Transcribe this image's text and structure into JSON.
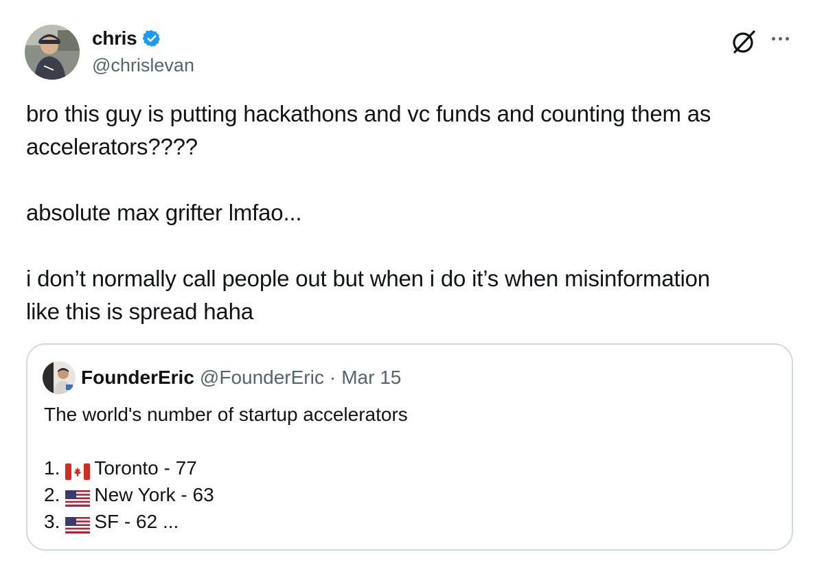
{
  "tweet": {
    "author": {
      "display_name": "chris",
      "handle": "@chrislevan",
      "verified": true,
      "avatar": "avatar-photo"
    },
    "actions": {
      "grok_icon": "grok-icon",
      "more_icon": "more-options-icon"
    },
    "text": {
      "line1": "bro this guy is putting hackathons and vc funds and counting them as",
      "line2": "accelerators????",
      "line3": "absolute max grifter lmfao...",
      "line4": "i don’t normally call people out but when i do it’s when misinformation",
      "line5": "like this is spread haha"
    }
  },
  "quote": {
    "author": {
      "display_name": "FounderEric",
      "handle": "@FounderEric",
      "separator": "·",
      "date": "Mar 15",
      "avatar": "avatar-photo"
    },
    "text": {
      "title": "The world's number of startup accelerators",
      "items": [
        {
          "rank": "1.",
          "flag": "canada-flag",
          "label": "Toronto - 77"
        },
        {
          "rank": "2.",
          "flag": "usa-flag",
          "label": "New York - 63"
        },
        {
          "rank": "3.",
          "flag": "usa-flag",
          "label": "SF - 62 ..."
        }
      ]
    }
  },
  "colors": {
    "text_primary": "#0f1419",
    "text_secondary": "#536471",
    "verified_blue": "#1d9bf0",
    "border": "#cfd9de"
  }
}
